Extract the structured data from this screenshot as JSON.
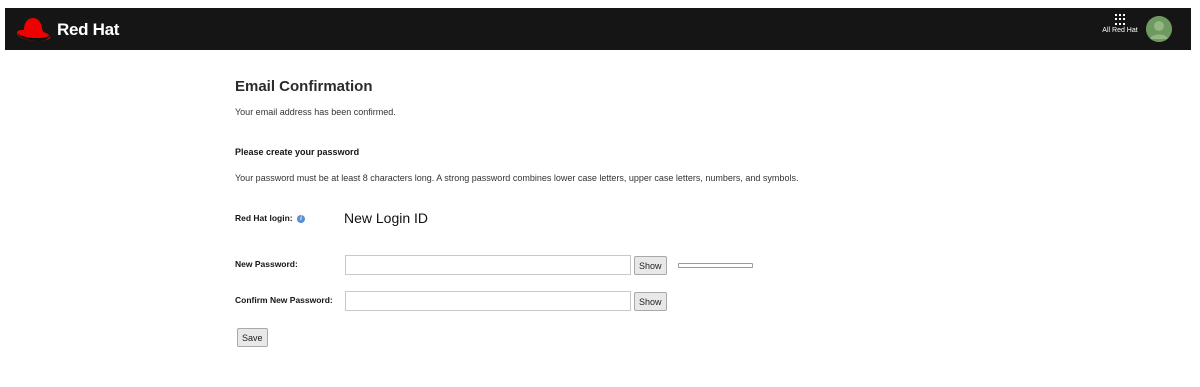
{
  "header": {
    "logo_text": "Red Hat",
    "apps_label": "All Red Hat"
  },
  "main": {
    "title": "Email Confirmation",
    "confirmed_message": "Your email address has been confirmed.",
    "section_heading": "Please create your password",
    "password_help": "Your password must be at least 8 characters long. A strong password combines lower case letters, upper case letters, numbers, and symbols.",
    "login_label": "Red Hat login:",
    "login_value": "New Login ID",
    "new_password_label": "New Password:",
    "new_password_value": "",
    "confirm_password_label": "Confirm New Password:",
    "confirm_password_value": "",
    "show_label": "Show",
    "strength_level": 0,
    "save_label": "Save"
  },
  "colors": {
    "header_bg": "#151515",
    "brand_red": "#ee0000"
  }
}
